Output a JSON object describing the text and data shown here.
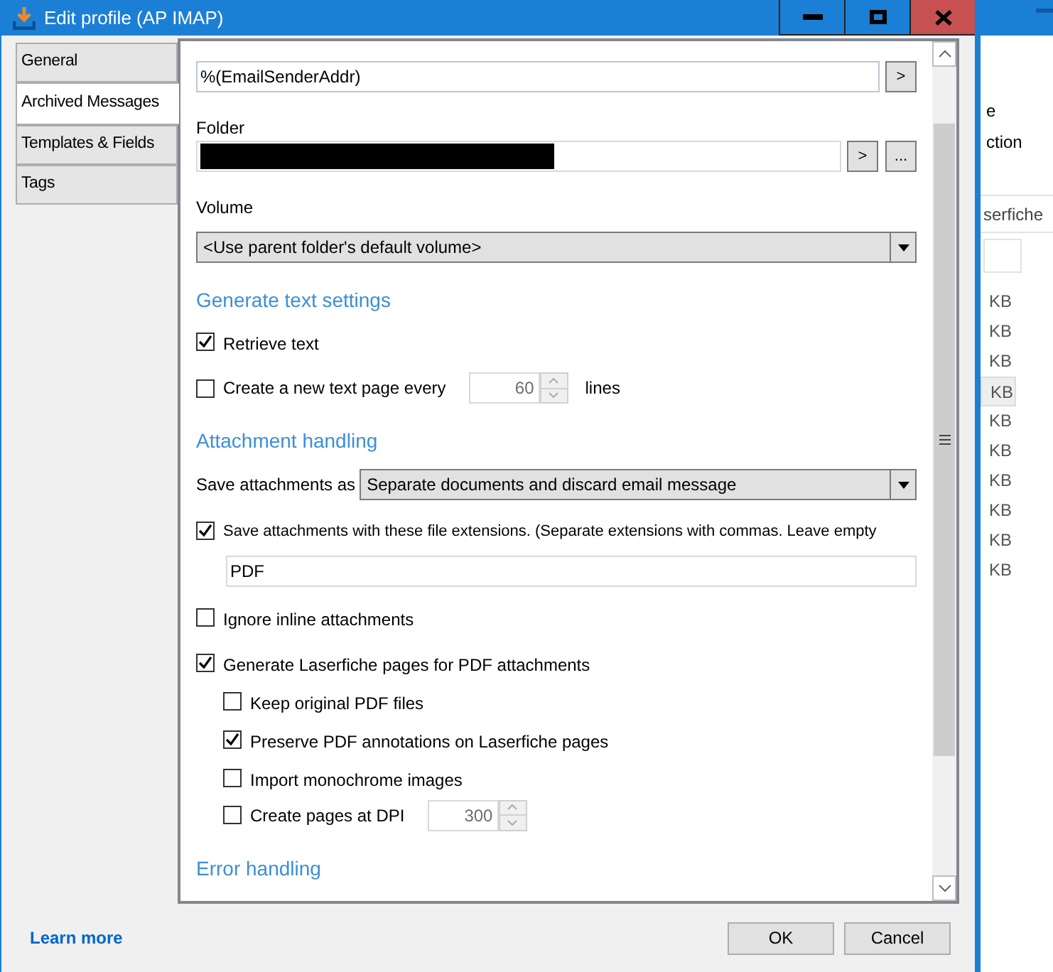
{
  "window": {
    "title": "Edit profile (AP IMAP)"
  },
  "tabs": [
    {
      "label": "General",
      "selected": false
    },
    {
      "label": "Archived Messages",
      "selected": true
    },
    {
      "label": "Templates & Fields",
      "selected": false
    },
    {
      "label": "Tags",
      "selected": false
    }
  ],
  "form": [
    {
      "kind": "field",
      "value": "%(EmailSenderAddr)",
      "buttons": [
        ">"
      ]
    },
    {
      "kind": "label",
      "text": "Folder"
    },
    {
      "kind": "field",
      "redacted": true,
      "buttons": [
        ">",
        "..."
      ]
    },
    {
      "kind": "label",
      "text": "Volume"
    },
    {
      "kind": "dropdown",
      "value": "<Use parent folder's default volume>"
    },
    {
      "kind": "heading",
      "text": "Generate text settings"
    },
    {
      "kind": "checkbox",
      "label": "Retrieve text",
      "checked": true
    },
    {
      "kind": "spin",
      "label": "Create a new text page every",
      "checked": false,
      "value": "60",
      "suffix": "lines"
    },
    {
      "kind": "heading",
      "text": "Attachment handling"
    },
    {
      "kind": "dropdown",
      "label": "Save attachments as",
      "value": "Separate documents and discard email message"
    },
    {
      "kind": "checkbox",
      "label": "Save attachments with these file extensions. (Separate extensions with commas. Leave empty",
      "checked": true
    },
    {
      "kind": "subfield",
      "value": "PDF"
    },
    {
      "kind": "checkbox",
      "label": "Ignore inline attachments",
      "checked": false
    },
    {
      "kind": "checkbox",
      "label": "Generate Laserfiche pages for PDF attachments",
      "checked": true,
      "children": [
        {
          "kind": "checkbox",
          "label": "Keep original PDF files",
          "checked": false
        },
        {
          "kind": "checkbox",
          "label": "Preserve PDF annotations on Laserfiche pages",
          "checked": true
        },
        {
          "kind": "checkbox",
          "label": "Import monochrome images",
          "checked": false
        },
        {
          "kind": "spin",
          "label": "Create pages at DPI",
          "checked": false,
          "value": "300"
        }
      ]
    },
    {
      "kind": "heading",
      "text": "Error handling"
    }
  ],
  "footer": {
    "link": "Learn more",
    "buttons": [
      "OK",
      "Cancel"
    ]
  },
  "background_window": {
    "texts": [
      "e",
      "ction"
    ],
    "column_header": "serfiche",
    "sizes": [
      {
        "text": "KB",
        "selected": false
      },
      {
        "text": "KB",
        "selected": false
      },
      {
        "text": "KB",
        "selected": false
      },
      {
        "text": "KB",
        "selected": true
      },
      {
        "text": "KB",
        "selected": false
      },
      {
        "text": "KB",
        "selected": false
      },
      {
        "text": "KB",
        "selected": false
      },
      {
        "text": "KB",
        "selected": false
      },
      {
        "text": "KB",
        "selected": false
      },
      {
        "text": "KB",
        "selected": false
      }
    ]
  }
}
